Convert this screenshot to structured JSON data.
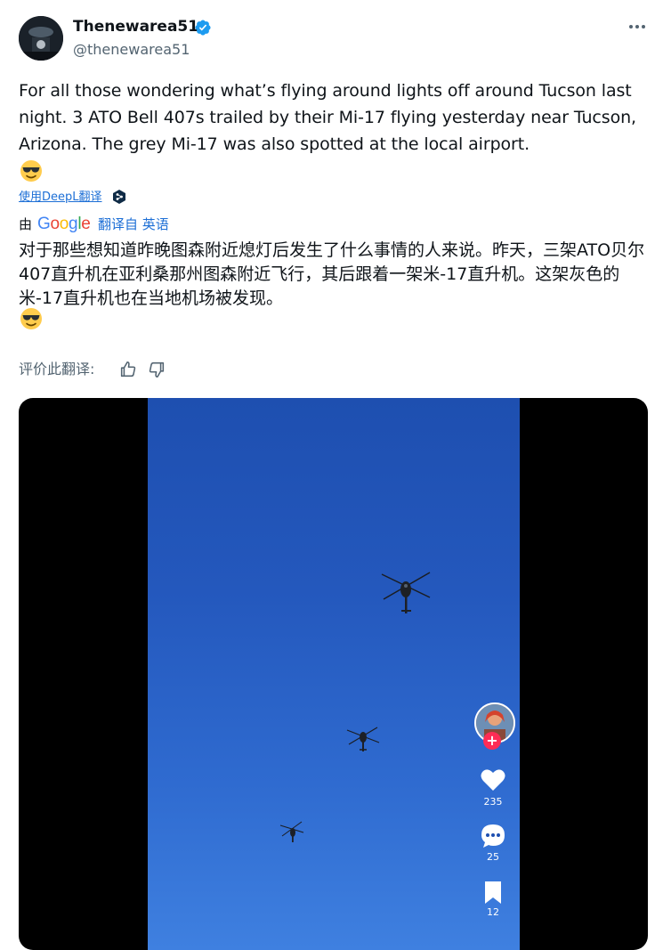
{
  "author": {
    "display_name": "Thenewarea51",
    "handle": "@thenewarea51",
    "verified": true
  },
  "tweet": {
    "text": "For all those wondering what’s flying around lights off around Tucson last night. 3 ATO Bell 407s trailed by their Mi-17 flying yesterday near Tucson, Arizona. The grey Mi-17 was also spotted at the local airport.",
    "emoji": "sunglasses-emoji"
  },
  "translation": {
    "deepl_link": "使用DeepL翻译",
    "by_label": "由",
    "provider": "Google",
    "from_label": "翻译自 英语",
    "text": "对于那些想知道昨晚图森附近熄灯后发生了什么事情的人来说。昨天，三架ATO贝尔407直升机在亚利桑那州图森附近飞行，其后跟着一架米-17直升机。这架灰色的米-17直升机也在当地机场被发现。",
    "rate_label": "评价此翻译:"
  },
  "video": {
    "likes": "235",
    "comments": "25",
    "saves": "12"
  },
  "colors": {
    "link_blue": "#1d6fd6",
    "verified_blue": "#1d9bf0",
    "muted": "#536471",
    "tiktok_red": "#fe2c55"
  }
}
